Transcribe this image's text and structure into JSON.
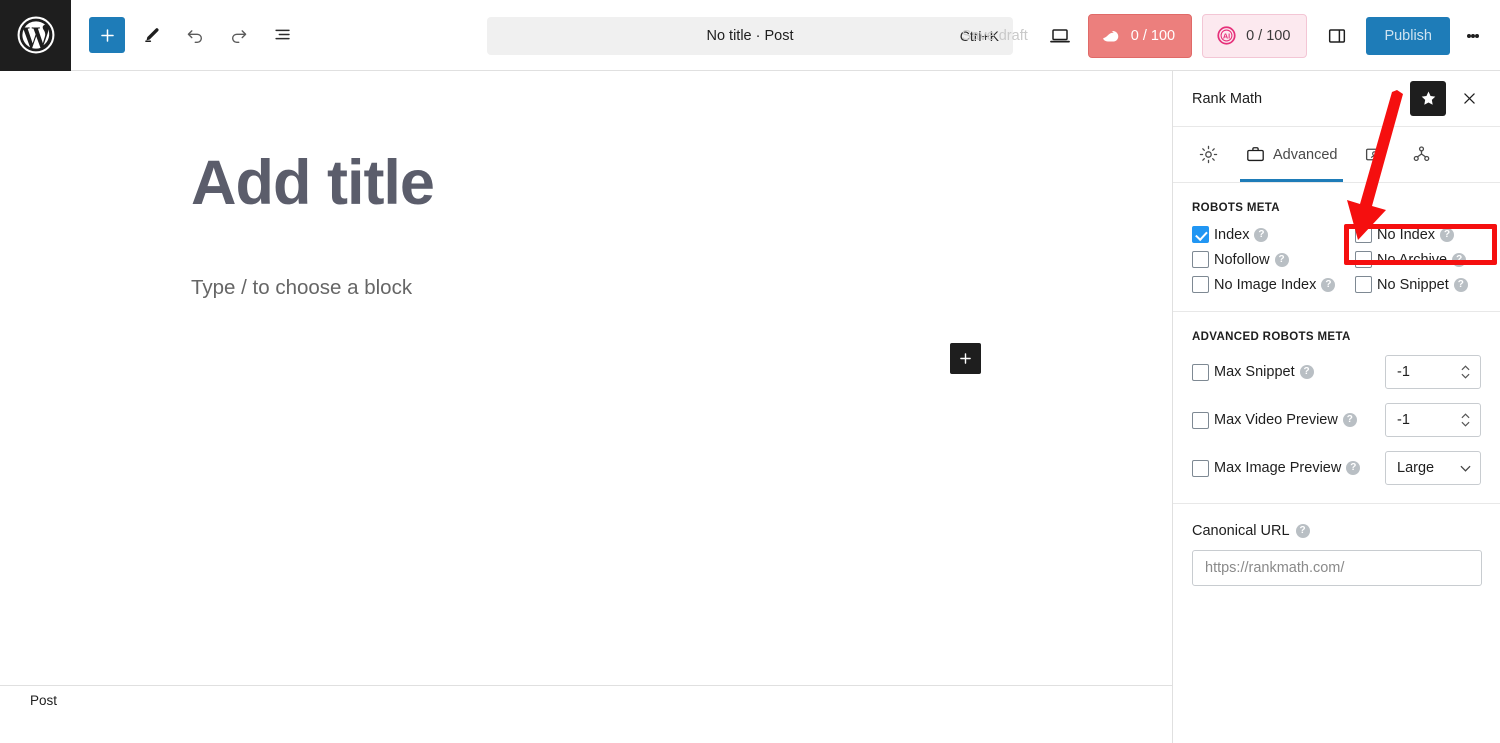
{
  "toolbar": {
    "logo_icon": "wordpress-logo-icon",
    "add_block_label": "+",
    "icons": [
      "add-block-icon",
      "pencil-edit-icon",
      "undo-icon",
      "redo-icon",
      "list-view-icon"
    ],
    "command_title": "No title · Post",
    "command_shortcut": "Ctrl+K",
    "save_draft_label": "Save draft",
    "preview_icon": "laptop-preview-icon",
    "seo_score": "0 / 100",
    "ai_score": "0 / 100",
    "sidebar_toggle_icon": "settings-sidebar-icon",
    "publish_label": "Publish",
    "options_icon": "kebab-menu-icon"
  },
  "editor": {
    "title_placeholder": "Add title",
    "block_placeholder": "Type / to choose a block",
    "add_block_icon": "plus-icon",
    "status_label": "Post"
  },
  "rank_math": {
    "title": "Rank Math",
    "star_icon": "star-favorite-icon",
    "close_icon": "close-icon",
    "tabs": [
      {
        "label": "",
        "icon": "gear-general-icon",
        "active": false
      },
      {
        "label": "Advanced",
        "icon": "briefcase-advanced-icon",
        "active": true
      },
      {
        "label": "",
        "icon": "social-card-icon",
        "active": false
      },
      {
        "label": "",
        "icon": "schema-share-icon",
        "active": false
      }
    ],
    "robots_meta": {
      "heading": "ROBOTS META",
      "options": [
        {
          "label": "Index",
          "checked": true
        },
        {
          "label": "No Index",
          "checked": false
        },
        {
          "label": "Nofollow",
          "checked": false
        },
        {
          "label": "No Archive",
          "checked": false
        },
        {
          "label": "No Image Index",
          "checked": false
        },
        {
          "label": "No Snippet",
          "checked": false
        }
      ],
      "help_icon": "help-question-icon"
    },
    "advanced_robots_meta": {
      "heading": "ADVANCED ROBOTS META",
      "rows": [
        {
          "label": "Max Snippet",
          "checked": false,
          "value": "-1",
          "control": "number"
        },
        {
          "label": "Max Video Preview",
          "checked": false,
          "value": "-1",
          "control": "number"
        },
        {
          "label": "Max Image Preview",
          "checked": false,
          "value": "Large",
          "control": "select"
        }
      ]
    },
    "canonical": {
      "label": "Canonical URL",
      "placeholder": "https://rankmath.com/",
      "value": ""
    }
  },
  "annotations": {
    "arrow": "red-pointer-arrow",
    "highlight": "red-highlight-box-no-index",
    "color": "#f50f0f"
  }
}
